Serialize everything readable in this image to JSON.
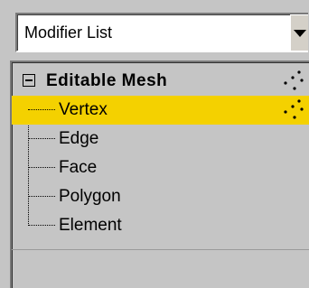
{
  "modifier_list": {
    "value": "Modifier List"
  },
  "stack": {
    "root": {
      "label": "Editable Mesh",
      "expanded": true,
      "icon": "subobject-dots-icon"
    },
    "subobjects": [
      {
        "label": "Vertex",
        "selected": true,
        "icon": "subobject-dots-icon"
      },
      {
        "label": "Edge",
        "selected": false
      },
      {
        "label": "Face",
        "selected": false
      },
      {
        "label": "Polygon",
        "selected": false
      },
      {
        "label": "Element",
        "selected": false
      }
    ]
  },
  "colors": {
    "panel_bg": "#c5c5c5",
    "selection_highlight": "#f4d100",
    "text": "#000000"
  }
}
